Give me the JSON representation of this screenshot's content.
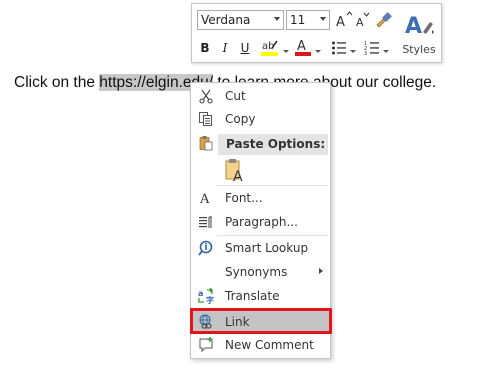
{
  "document": {
    "before": "Click on the ",
    "selected": "https://elgin.edu/",
    "after": " to learn more about our college."
  },
  "mini_toolbar": {
    "font": "Verdana",
    "size": "11",
    "bold": "B",
    "italic": "I",
    "underline": "U",
    "styles_label": "Styles"
  },
  "context_menu": {
    "items": [
      {
        "label": "Cut",
        "icon": "scissors-icon"
      },
      {
        "label": "Copy",
        "icon": "copy-icon"
      },
      {
        "label": "Paste Options:",
        "icon": "clipboard-icon"
      },
      {
        "label": "Font...",
        "icon": "font-icon"
      },
      {
        "label": "Paragraph...",
        "icon": "paragraph-icon"
      },
      {
        "label": "Smart Lookup",
        "icon": "smart-lookup-icon"
      },
      {
        "label": "Synonyms",
        "icon": ""
      },
      {
        "label": "Translate",
        "icon": "translate-icon"
      },
      {
        "label": "Link",
        "icon": "link-icon"
      },
      {
        "label": "New Comment",
        "icon": "comment-icon"
      }
    ]
  },
  "colors": {
    "highlight_box": "#e2141c",
    "font_color_bar": "#e2141c",
    "highlighter_bar": "#ffff00",
    "selection": "#c8c8c8"
  }
}
